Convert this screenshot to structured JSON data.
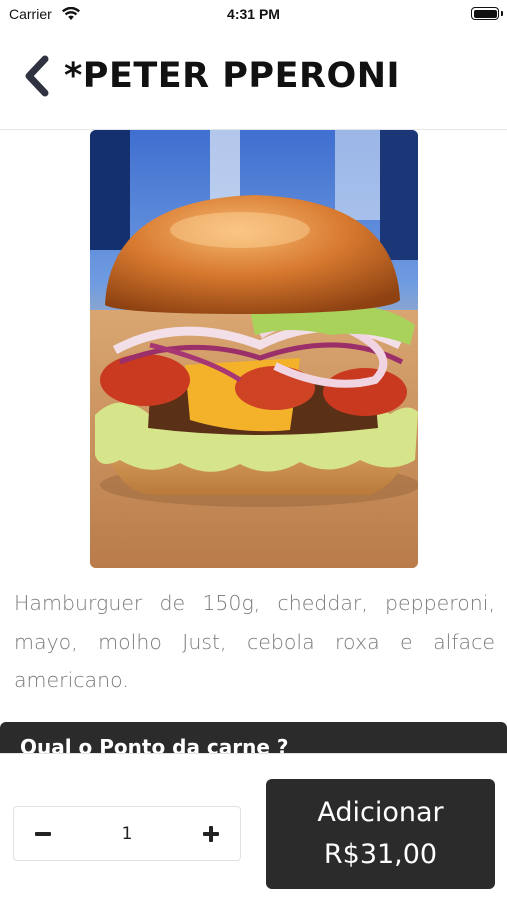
{
  "status_bar": {
    "carrier": "Carrier",
    "time": "4:31 PM",
    "wifi_icon": "wifi-icon",
    "battery_icon": "battery-icon"
  },
  "header": {
    "back_icon": "chevron-left-icon",
    "title": "*PETER PPERONI"
  },
  "product": {
    "image_description": "burger-photo",
    "description": "Hamburguer de 150g, cheddar, pepperoni, mayo, molho Just, cebola roxa e alface americano."
  },
  "options": {
    "section_title": "Qual o Ponto da carne ?"
  },
  "footer": {
    "quantity": "1",
    "minus_icon": "minus-icon",
    "plus_icon": "plus-icon",
    "add_label": "Adicionar",
    "add_price": "R$31,00"
  },
  "colors": {
    "accent": "#2b2b2b",
    "text": "#111111",
    "muted_text": "#7a7a7a"
  }
}
